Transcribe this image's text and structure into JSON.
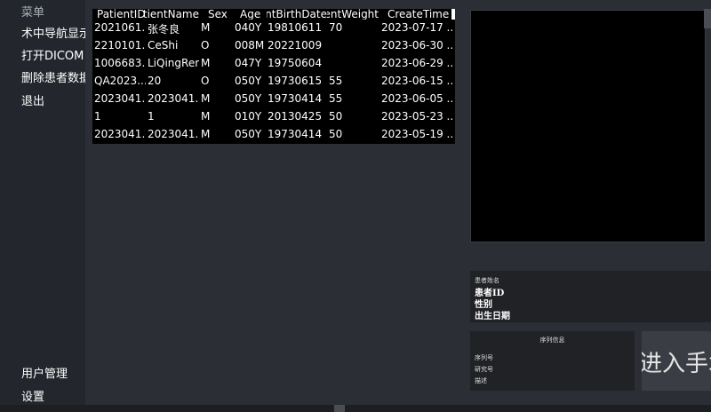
{
  "sidebar": {
    "title": "菜单",
    "items": [
      {
        "label": "术中导航显示"
      },
      {
        "label": "打开DICOM"
      },
      {
        "label": "删除患者数据"
      },
      {
        "label": "退出"
      }
    ],
    "bottom_items": [
      {
        "label": "用户管理"
      },
      {
        "label": "设置"
      }
    ]
  },
  "table": {
    "headers": [
      "PatientID",
      "PatientName",
      "Sex",
      "Age",
      "PatientBirthDate",
      "PatientWeight",
      "CreateTime"
    ],
    "rows": [
      [
        "2021061...",
        "张冬良",
        "M",
        "040Y",
        "19810611",
        "70",
        "2023-07-17 ..."
      ],
      [
        "2210101...",
        "CeShi",
        "O",
        "008M",
        "20221009",
        "",
        "2023-06-30 ..."
      ],
      [
        "1006683...",
        "LiQingRen",
        "M",
        "047Y",
        "19750604",
        "",
        "2023-06-29 ..."
      ],
      [
        "QA2023...",
        "20",
        "O",
        "050Y",
        "19730615",
        "55",
        "2023-06-15 ..."
      ],
      [
        "2023041...",
        "2023041...",
        "M",
        "050Y",
        "19730414",
        "55",
        "2023-06-05 ..."
      ],
      [
        "1",
        "1",
        "M",
        "010Y",
        "20130425",
        "50",
        "2023-05-23 ..."
      ],
      [
        "2023041...",
        "2023041...",
        "M",
        "050Y",
        "19730414",
        "50",
        "2023-05-19 ..."
      ]
    ]
  },
  "patient_info": {
    "name_label": "患者姓名",
    "id_label": "患者ID",
    "sex_label": "性别",
    "birth_label": "出生日期"
  },
  "series_info": {
    "title": "序列信息",
    "series_no_label": "序列号",
    "study_no_label": "研究号",
    "description_label": "描述"
  },
  "enter_button": {
    "label": "进入手术"
  }
}
